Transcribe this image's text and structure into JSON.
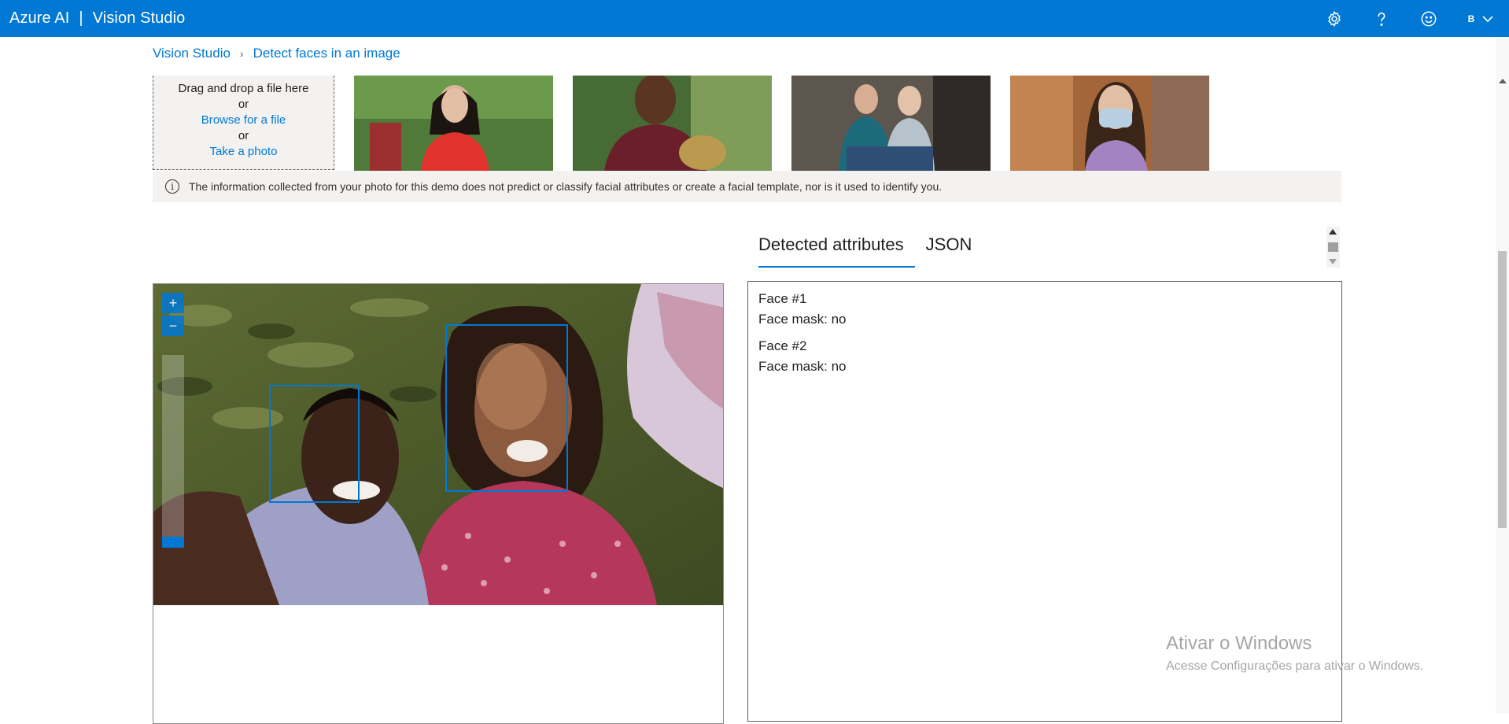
{
  "header": {
    "brand": "Azure AI",
    "separator": "|",
    "product": "Vision Studio",
    "icons": [
      "settings-icon",
      "help-icon",
      "feedback-smiley-icon",
      "chevron-down-icon"
    ],
    "avatar_letter": "B",
    "bar_color": "#0078d4"
  },
  "breadcrumb": {
    "root": "Vision Studio",
    "current": "Detect faces in an image"
  },
  "upload": {
    "line1": "Drag and drop a file here",
    "or1": "or",
    "browse": "Browse for a file",
    "or2": "or",
    "take_photo": "Take a photo"
  },
  "samples": {
    "count": 4
  },
  "info": {
    "text": "The information collected from your photo for this demo does not predict or classify facial attributes or create a facial template, nor is it used to identify you."
  },
  "tabs": [
    {
      "label": "Detected attributes",
      "active": true
    },
    {
      "label": "JSON",
      "active": false
    }
  ],
  "image_panel": {
    "zoom_in": "+",
    "zoom_out": "−"
  },
  "results": {
    "faces": [
      {
        "title": "Face #1",
        "mask": "Face mask: no"
      },
      {
        "title": "Face #2",
        "mask": "Face mask: no"
      }
    ]
  },
  "watermark": {
    "line1": "Ativar o Windows",
    "line2": "Acesse Configurações para ativar o Windows."
  }
}
